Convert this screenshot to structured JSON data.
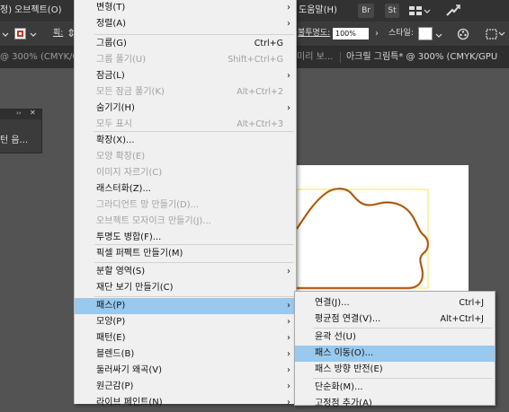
{
  "menubar": {
    "items": [
      "정)",
      "오브젝트(O)",
      "도움말(H)"
    ],
    "br_label": "Br",
    "st_label": "St"
  },
  "controlbar": {
    "stroke_label": "획:",
    "opacity_label": "불투명도:",
    "opacity_value": "100%",
    "style_label": "스타일:",
    "stroke_color": "#c0392b"
  },
  "tabbar": {
    "left_tab": "@ 300% (CMYK/G",
    "mid_tab": "미리 보...",
    "right_tab": "아크릴 그림특* @ 300% (CMYK/GPU"
  },
  "panel": {
    "text": "턴 음..."
  },
  "menu": {
    "items": [
      {
        "label": "변형(T)",
        "shortcut": "",
        "submenu": true,
        "disabled": false
      },
      {
        "label": "정렬(A)",
        "shortcut": "",
        "submenu": true,
        "disabled": false
      },
      {
        "label": "그룹(G)",
        "shortcut": "Ctrl+G",
        "submenu": false,
        "disabled": false
      },
      {
        "label": "그룹 풀기(U)",
        "shortcut": "Shift+Ctrl+G",
        "submenu": false,
        "disabled": true
      },
      {
        "label": "잠금(L)",
        "shortcut": "",
        "submenu": true,
        "disabled": false
      },
      {
        "label": "모든 잠금 풀기(K)",
        "shortcut": "Alt+Ctrl+2",
        "submenu": false,
        "disabled": true
      },
      {
        "label": "숨기기(H)",
        "shortcut": "",
        "submenu": true,
        "disabled": false
      },
      {
        "label": "모두 표시",
        "shortcut": "Alt+Ctrl+3",
        "submenu": false,
        "disabled": true
      },
      {
        "label": "확장(X)...",
        "shortcut": "",
        "submenu": false,
        "disabled": false
      },
      {
        "label": "모양 확장(E)",
        "shortcut": "",
        "submenu": false,
        "disabled": true
      },
      {
        "label": "이미지 자르기(C)",
        "shortcut": "",
        "submenu": false,
        "disabled": true
      },
      {
        "label": "래스터화(Z)...",
        "shortcut": "",
        "submenu": false,
        "disabled": false
      },
      {
        "label": "그라디언트 망 만들기(D)...",
        "shortcut": "",
        "submenu": false,
        "disabled": true
      },
      {
        "label": "오브젝트 모자이크 만들기(J)...",
        "shortcut": "",
        "submenu": false,
        "disabled": true
      },
      {
        "label": "투명도 병합(F)...",
        "shortcut": "",
        "submenu": false,
        "disabled": false
      },
      {
        "label": "픽셀 퍼펙트 만들기(M)",
        "shortcut": "",
        "submenu": false,
        "disabled": false
      },
      {
        "label": "분할 영역(S)",
        "shortcut": "",
        "submenu": true,
        "disabled": false
      },
      {
        "label": "재단 보기 만들기(C)",
        "shortcut": "",
        "submenu": false,
        "disabled": false
      },
      {
        "label": "패스(P)",
        "shortcut": "",
        "submenu": true,
        "disabled": false,
        "highlighted": true
      },
      {
        "label": "모양(P)",
        "shortcut": "",
        "submenu": true,
        "disabled": false
      },
      {
        "label": "패턴(E)",
        "shortcut": "",
        "submenu": true,
        "disabled": false
      },
      {
        "label": "블렌드(B)",
        "shortcut": "",
        "submenu": true,
        "disabled": false
      },
      {
        "label": "둘러싸기 왜곡(V)",
        "shortcut": "",
        "submenu": true,
        "disabled": false
      },
      {
        "label": "원근감(P)",
        "shortcut": "",
        "submenu": true,
        "disabled": false
      },
      {
        "label": "라이브 페인트(N)",
        "shortcut": "",
        "submenu": true,
        "disabled": false
      }
    ]
  },
  "submenu": {
    "items": [
      {
        "label": "연결(J)...",
        "shortcut": "Ctrl+J"
      },
      {
        "label": "평균점 연결(V)...",
        "shortcut": "Alt+Ctrl+J"
      },
      {
        "label": "윤곽 선(U)",
        "shortcut": ""
      },
      {
        "label": "패스 이동(O)...",
        "shortcut": "",
        "highlighted": true
      },
      {
        "label": "패스 방향 반전(E)",
        "shortcut": ""
      },
      {
        "label": "단순화(M)...",
        "shortcut": ""
      },
      {
        "label": "고정점 추가(A)",
        "shortcut": ""
      }
    ]
  }
}
